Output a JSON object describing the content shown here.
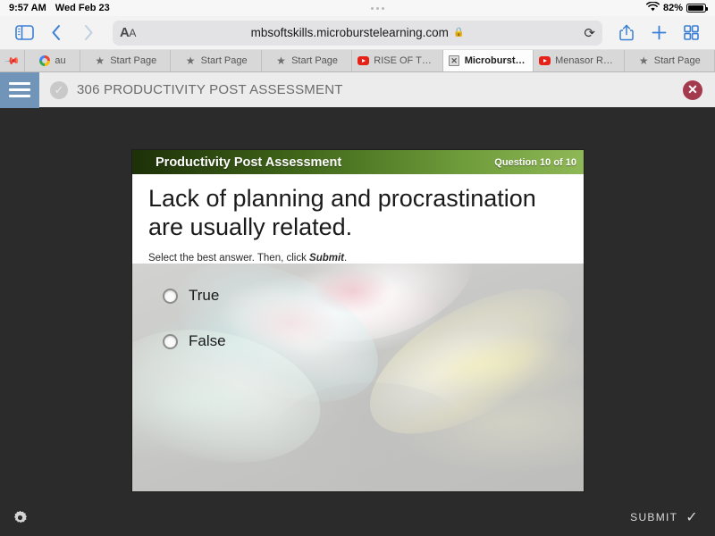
{
  "status_bar": {
    "time": "9:57 AM",
    "date": "Wed Feb 23",
    "wifi_icon": "wifi-icon",
    "battery_percent": "82%",
    "battery_icon": "battery-icon"
  },
  "browser": {
    "sidebar_icon": "sidebar-icon",
    "back_icon": "chevron-left-icon",
    "forward_icon": "chevron-right-icon",
    "text_size_label": "AA",
    "url": "mbsoftskills.microburstelearning.com",
    "lock_icon": "lock-icon",
    "reload_icon": "reload-icon",
    "share_icon": "share-icon",
    "new_tab_icon": "plus-icon",
    "tab_overview_icon": "tab-grid-icon",
    "tabs": [
      {
        "label": "",
        "icon": "pin-icon",
        "type": "pinned",
        "active": false
      },
      {
        "label": "au",
        "icon": "google-icon",
        "type": "narrow",
        "active": false
      },
      {
        "label": "Start Page",
        "icon": "star-icon",
        "type": "flexi",
        "active": false
      },
      {
        "label": "Start Page",
        "icon": "star-icon",
        "type": "flexi",
        "active": false
      },
      {
        "label": "Start Page",
        "icon": "star-icon",
        "type": "flexi",
        "active": false
      },
      {
        "label": "RISE OF THE…",
        "icon": "youtube-icon",
        "type": "flexi",
        "active": false
      },
      {
        "label": "Microburst L…",
        "icon": "square-icon",
        "type": "flexi",
        "active": true
      },
      {
        "label": "Menasor Ro…",
        "icon": "youtube-icon",
        "type": "flexi",
        "active": false
      },
      {
        "label": "Start Page",
        "icon": "star-icon",
        "type": "flexi",
        "active": false
      }
    ]
  },
  "course_header": {
    "menu_icon": "hamburger-icon",
    "status_icon": "check-circle-icon",
    "title": "306 PRODUCTIVITY POST ASSESSMENT",
    "close_icon": "close-icon"
  },
  "slide": {
    "header_title": "Productivity Post Assessment",
    "question_counter": "Question 10 of 10",
    "question": "Lack of planning and procrastination are usually related.",
    "hint_prefix": "Select the best answer. Then, click ",
    "hint_emphasis": "Submit",
    "hint_suffix": ".",
    "options": [
      {
        "label": "True",
        "selected": false
      },
      {
        "label": "False",
        "selected": false
      }
    ]
  },
  "bottom_bar": {
    "settings_icon": "gear-icon",
    "submit_label": "SUBMIT",
    "submit_icon": "check-icon"
  },
  "colors": {
    "accent_blue": "#3a7fd5",
    "header_green": "#41681a",
    "close_red": "#a43a4d",
    "hamburger_blue": "#7095b8",
    "stage_dark": "#2b2b2b"
  }
}
